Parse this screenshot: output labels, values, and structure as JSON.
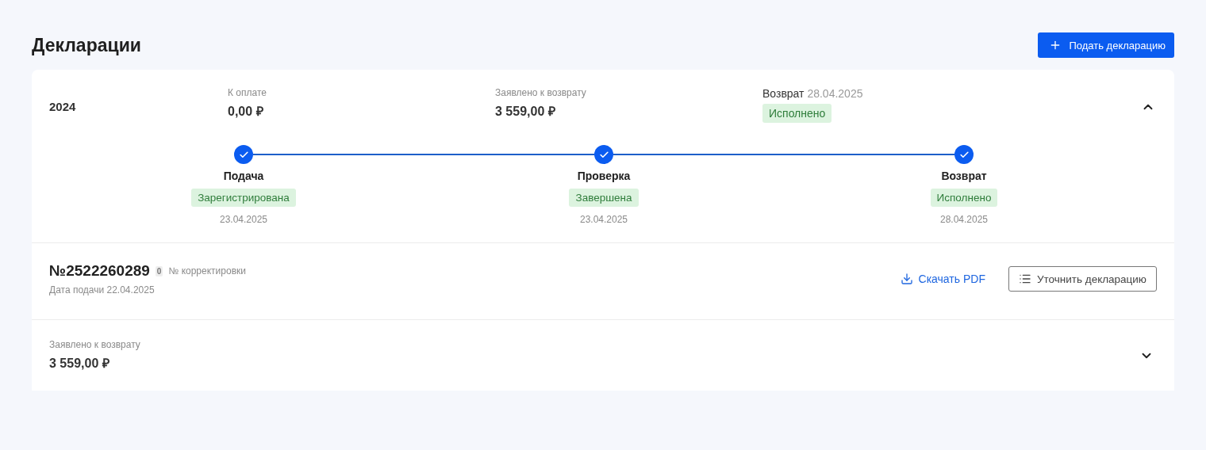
{
  "page_title": "Декларации",
  "add_button": {
    "label": "Подать декларацию"
  },
  "declaration": {
    "year": "2024",
    "expanded": true,
    "to_pay": {
      "label": "К оплате",
      "amount": "0,00 ₽"
    },
    "claimed": {
      "label": "Заявлено к возврату",
      "amount": "3 559,00 ₽"
    },
    "refund": {
      "label": "Возврат",
      "date": "28.04.2025",
      "status": "Исполнено"
    },
    "steps": [
      {
        "title": "Подача",
        "status": "Зарегистрирована",
        "date": "23.04.2025",
        "completed": true
      },
      {
        "title": "Проверка",
        "status": "Завершена",
        "date": "23.04.2025",
        "completed": true
      },
      {
        "title": "Возврат",
        "status": "Исполнено",
        "date": "28.04.2025",
        "completed": true
      }
    ],
    "number": "№2522260289",
    "correction_count": "0",
    "correction_label": "№ корректировки",
    "filed_date": "Дата подачи 22.04.2025",
    "download_link": "Скачать PDF",
    "clarify_button": "Уточнить декларацию",
    "summary": {
      "label": "Заявлено к возврату",
      "amount": "3 559,00 ₽",
      "expanded": false
    }
  }
}
